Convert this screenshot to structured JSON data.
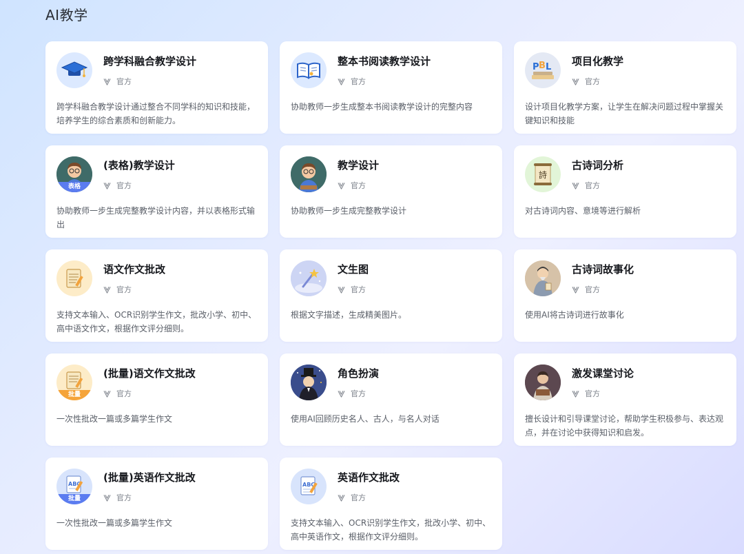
{
  "page": {
    "title": "AI教学"
  },
  "colors": {
    "tag_blue": "#5b7cf0",
    "tag_orange": "#f5a43a"
  },
  "cards": [
    {
      "title": "跨学科融合教学设计",
      "badge": "官方",
      "desc": "跨学科融合教学设计通过整合不同学科的知识和技能，培养学生的综合素质和创新能力。",
      "icon": "graduation-cap-icon"
    },
    {
      "title": "整本书阅读教学设计",
      "badge": "官方",
      "desc": "协助教师一步生成整本书阅读教学设计的完整内容",
      "icon": "open-book-icon"
    },
    {
      "title": "项目化教学",
      "badge": "官方",
      "desc": "设计项目化教学方案，让学生在解决问题过程中掌握关键知识和技能",
      "icon": "pbl-books-icon"
    },
    {
      "title": "(表格)教学设计",
      "badge": "官方",
      "desc": "协助教师一步生成完整教学设计内容，并以表格形式输出",
      "icon": "teacher-avatar-icon",
      "tag": "表格"
    },
    {
      "title": "教学设计",
      "badge": "官方",
      "desc": "协助教师一步生成完整教学设计",
      "icon": "teacher-avatar-icon"
    },
    {
      "title": "古诗词分析",
      "badge": "官方",
      "desc": "对古诗词内容、意境等进行解析",
      "icon": "poem-scroll-icon"
    },
    {
      "title": "语文作文批改",
      "badge": "官方",
      "desc": "支持文本输入、OCR识别学生作文，批改小学、初中、高中语文作文，根据作文评分细则。",
      "icon": "notepad-pencil-icon"
    },
    {
      "title": "文生图",
      "badge": "官方",
      "desc": "根据文字描述，生成精美图片。",
      "icon": "magic-wand-icon"
    },
    {
      "title": "古诗词故事化",
      "badge": "官方",
      "desc": "使用AI将古诗词进行故事化",
      "icon": "ancient-scholar-icon"
    },
    {
      "title": "(批量)语文作文批改",
      "badge": "官方",
      "desc": "一次性批改一篇或多篇学生作文",
      "icon": "notepad-pencil-icon",
      "tag": "批量"
    },
    {
      "title": "角色扮演",
      "badge": "官方",
      "desc": "使用AI回顾历史名人、古人，与名人对话",
      "icon": "top-hat-character-icon"
    },
    {
      "title": "激发课堂讨论",
      "badge": "官方",
      "desc": "擅长设计和引导课堂讨论，帮助学生积极参与、表达观点，并在讨论中获得知识和启发。",
      "icon": "reading-student-icon"
    },
    {
      "title": "(批量)英语作文批改",
      "badge": "官方",
      "desc": "一次性批改一篇或多篇学生作文",
      "icon": "abc-notepad-icon",
      "tag": "批量"
    },
    {
      "title": "英语作文批改",
      "badge": "官方",
      "desc": "支持文本输入、OCR识别学生作文，批改小学、初中、高中英语作文，根据作文评分细则。",
      "icon": "abc-notepad-icon"
    }
  ]
}
